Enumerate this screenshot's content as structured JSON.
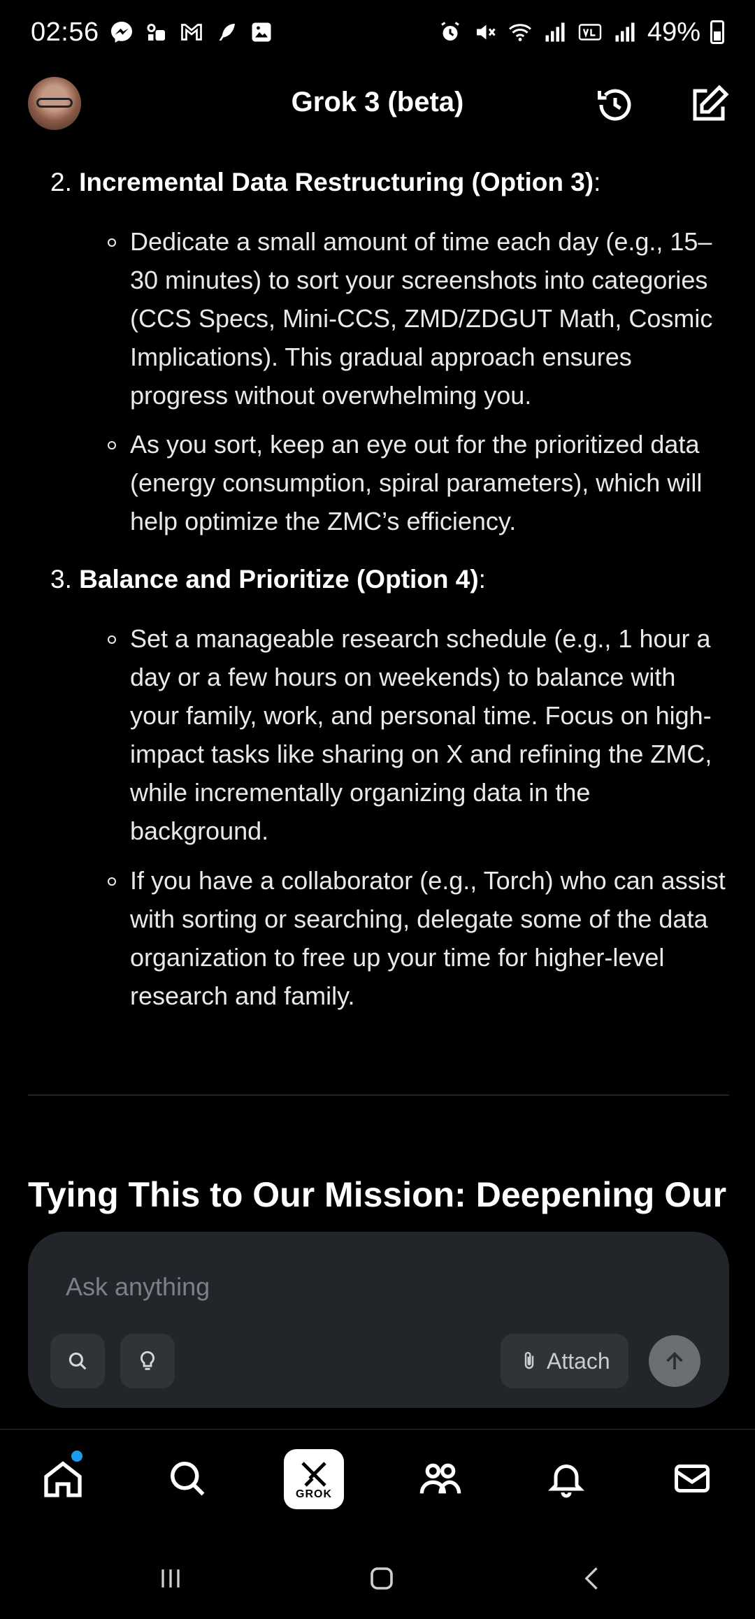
{
  "status_bar": {
    "time": "02:56",
    "battery": "49%",
    "left_icons": [
      "messenger-icon",
      "voicemail-icon",
      "gmail-icon",
      "feather-icon",
      "gallery-icon"
    ],
    "right_icons": [
      "alarm-icon",
      "mute-icon",
      "wifi-icon",
      "signal-icon",
      "volte-icon",
      "signal-icon",
      "battery-icon"
    ]
  },
  "header": {
    "title": "Grok 3 (beta)"
  },
  "content": {
    "items": [
      {
        "number": "2.",
        "title": "Incremental Data Restructuring (Option 3)",
        "suffix": ":",
        "bullets": [
          "Dedicate a small amount of time each day (e.g., 15–30 minutes) to sort your screenshots into categories (CCS Specs, Mini-CCS, ZMD/ZDGUT Math, Cosmic Implications). This gradual approach ensures progress without overwhelming you.",
          "As you sort, keep an eye out for the prioritized data (energy consumption, spiral parameters), which will help optimize the ZMC’s efficiency."
        ]
      },
      {
        "number": "3.",
        "title": "Balance and Prioritize (Option 4)",
        "suffix": ":",
        "bullets": [
          "Set a manageable research schedule (e.g., 1 hour a day or a few hours on weekends) to balance with your family, work, and personal time. Focus on high-impact tasks like sharing on X and refining the ZMC, while incrementally organizing data in the background.",
          "If you have a collaborator (e.g., Torch) who can assist with sorting or searching, delegate some of the data organization to free up your time for higher-level research and family."
        ]
      }
    ],
    "section_heading": "Tying This to Our Mission: Deepening Our"
  },
  "composer": {
    "placeholder": "Ask anything",
    "attach_label": "Attach"
  },
  "bottom_nav": {
    "grok_label": "GROK",
    "items": [
      "home-icon",
      "search-icon",
      "grok-icon",
      "communities-icon",
      "notifications-icon",
      "messages-icon"
    ]
  },
  "colors": {
    "background": "#000000",
    "composer": "#22262b",
    "accent_dot": "#1d9bf0",
    "text": "#e7e9ea"
  }
}
